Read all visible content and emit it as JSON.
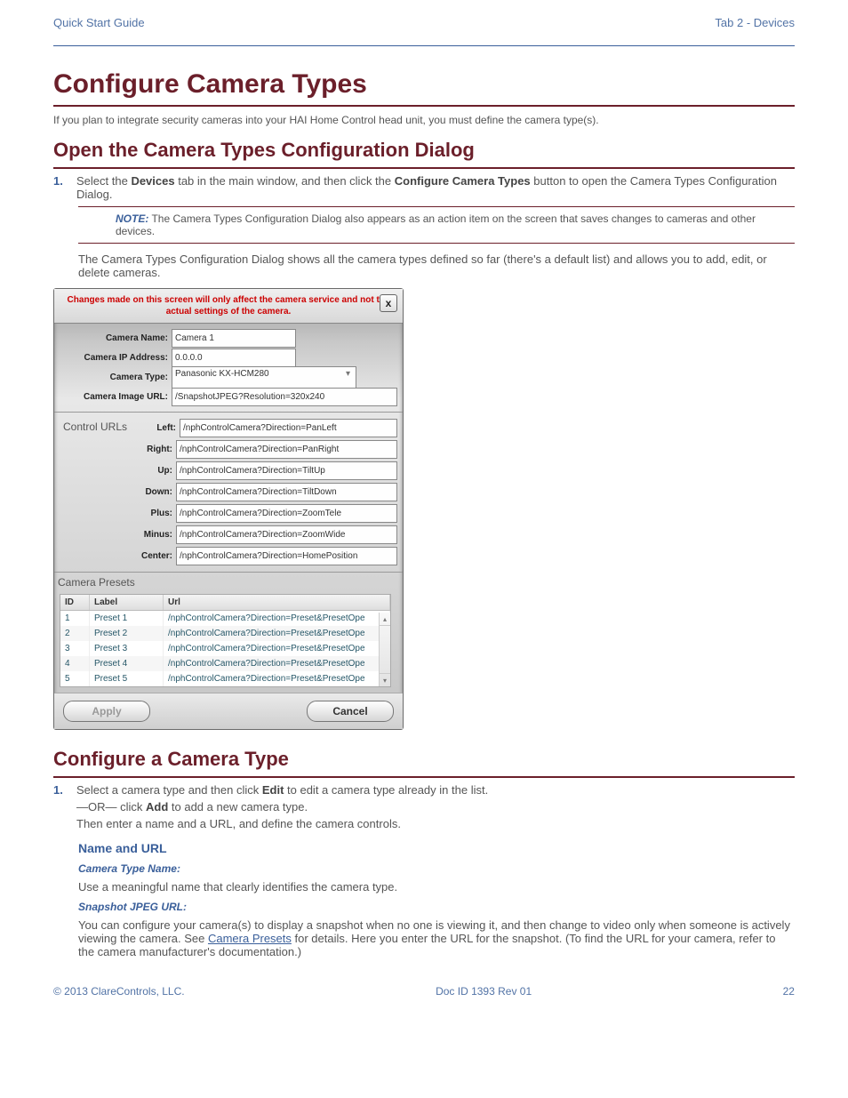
{
  "header": {
    "left": "Quick Start Guide",
    "right": "Tab 2 - Devices"
  },
  "h1": "Configure Camera Types",
  "p1": "If you plan to integrate security cameras into your HAI Home Control head unit, you must define the camera type(s).",
  "h2_1": "Open the Camera Types Configuration Dialog",
  "step1": {
    "num": "1.",
    "body_prefix": "Select the ",
    "bold1": "Devices",
    "body_mid": " tab in the main window, and then click the ",
    "bold2": "Configure Camera Types",
    "body_suffix": " button to open the Camera Types Configuration Dialog."
  },
  "note1": {
    "label": "NOTE:",
    "text": " The Camera Types Configuration Dialog also appears as an action item on the screen that saves changes to cameras and other devices."
  },
  "p2": "The Camera Types Configuration Dialog shows all the camera types defined so far (there's a default list) and allows you to add, edit, or delete cameras.",
  "dialog": {
    "warning": "Changes made on this screen will only affect the camera service and not the actual settings of the camera.",
    "close": "x",
    "labels": {
      "name": "Camera Name:",
      "ip": "Camera IP Address:",
      "type": "Camera Type:",
      "img": "Camera Image URL:",
      "ctrl_section": "Control URLs",
      "left": "Left:",
      "right": "Right:",
      "up": "Up:",
      "down": "Down:",
      "plus": "Plus:",
      "minus": "Minus:",
      "center": "Center:",
      "presets": "Camera Presets"
    },
    "values": {
      "name": "Camera 1",
      "ip": "0.0.0.0",
      "type": "Panasonic KX-HCM280",
      "img": "/SnapshotJPEG?Resolution=320x240",
      "left": "/nphControlCamera?Direction=PanLeft",
      "right": "/nphControlCamera?Direction=PanRight",
      "up": "/nphControlCamera?Direction=TiltUp",
      "down": "/nphControlCamera?Direction=TiltDown",
      "plus": "/nphControlCamera?Direction=ZoomTele",
      "minus": "/nphControlCamera?Direction=ZoomWide",
      "center": "/nphControlCamera?Direction=HomePosition"
    },
    "table": {
      "headers": {
        "id": "ID",
        "label": "Label",
        "url": "Url"
      },
      "rows": [
        {
          "id": "1",
          "label": "Preset 1",
          "url": "/nphControlCamera?Direction=Preset&PresetOpe"
        },
        {
          "id": "2",
          "label": "Preset 2",
          "url": "/nphControlCamera?Direction=Preset&PresetOpe"
        },
        {
          "id": "3",
          "label": "Preset 3",
          "url": "/nphControlCamera?Direction=Preset&PresetOpe"
        },
        {
          "id": "4",
          "label": "Preset 4",
          "url": "/nphControlCamera?Direction=Preset&PresetOpe"
        },
        {
          "id": "5",
          "label": "Preset 5",
          "url": "/nphControlCamera?Direction=Preset&PresetOpe"
        }
      ]
    },
    "buttons": {
      "apply": "Apply",
      "cancel": "Cancel"
    }
  },
  "h2_2": "Configure a Camera Type",
  "step2_1": {
    "num": "1.",
    "body_prefix": "Select a camera type and then click ",
    "bold": "Edit",
    "body_suffix": " to edit a camera type already in the list."
  },
  "step2_1_alt": {
    "prefix": "—OR— click ",
    "bold": "Add",
    "suffix": " to add a new camera type."
  },
  "step2_1_body2": "Then enter a name and a URL, and define the camera controls.",
  "h3": "Name and URL",
  "h4_name": "Camera Type Name:",
  "name_body": "Use a meaningful name that clearly identifies the camera type.",
  "h4_url": "Snapshot JPEG URL:",
  "url_body": {
    "prefix": "You can configure your camera(s) to display a snapshot when no one is viewing it, and then change to video only when someone is actively viewing the camera. See ",
    "link": "Camera Presets",
    "suffix": " for details. Here you enter the URL for the snapshot. (To find the URL for your camera, refer to the camera manufacturer's documentation.)"
  },
  "footer": {
    "left": "© 2013 ClareControls, LLC.",
    "center": "Doc ID 1393 Rev 01",
    "right": "22"
  }
}
